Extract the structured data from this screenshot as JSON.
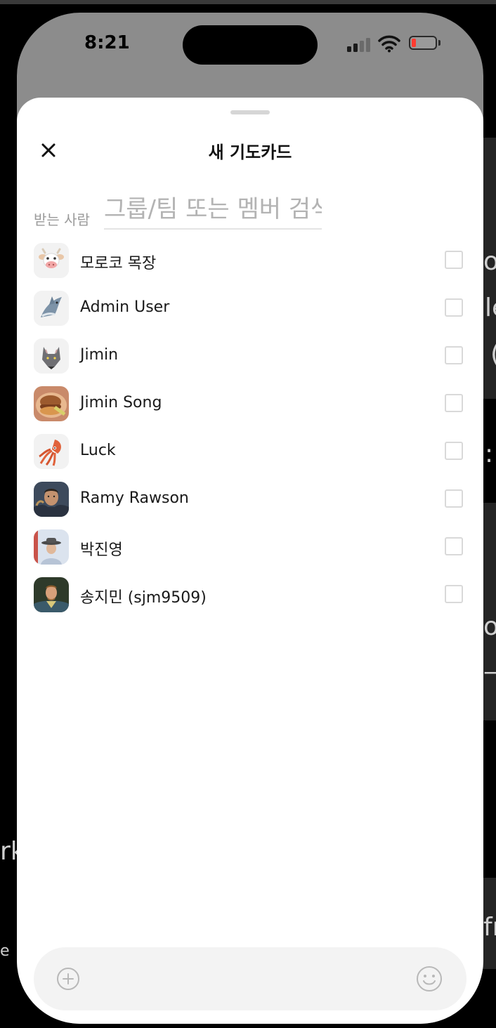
{
  "status_bar": {
    "time": "8:21"
  },
  "background_fragments": [
    "o",
    "le",
    "(",
    ":",
    "o",
    "—",
    "rk",
    "fr",
    "e"
  ],
  "sheet": {
    "title": "새 기도카드",
    "close_icon": "close-x-icon"
  },
  "recipient": {
    "label": "받는 사람",
    "placeholder": "그룹/팀 또는 멤버 검색",
    "value": ""
  },
  "members": [
    {
      "name": "모로코 목장",
      "avatar": "cow-emoji-icon",
      "checked": false
    },
    {
      "name": "Admin User",
      "avatar": "shark-emoji-icon",
      "checked": false
    },
    {
      "name": "Jimin",
      "avatar": "wolf-emoji-icon",
      "checked": false
    },
    {
      "name": "Jimin Song",
      "avatar": "food-photo",
      "checked": false
    },
    {
      "name": "Luck",
      "avatar": "squid-emoji-icon",
      "checked": false
    },
    {
      "name": "Ramy Rawson",
      "avatar": "person-photo",
      "checked": false
    },
    {
      "name": "박진영",
      "avatar": "person-hat-photo",
      "checked": false
    },
    {
      "name": "송지민 (sjm9509)",
      "avatar": "person-painting-photo",
      "checked": false
    }
  ],
  "composer": {
    "add_icon": "plus-circle-icon",
    "emoji_icon": "smiley-icon"
  },
  "colors": {
    "battery_low": "#ff3b30",
    "sheet_bg": "#ffffff",
    "backdrop": "#8c8c8c"
  }
}
